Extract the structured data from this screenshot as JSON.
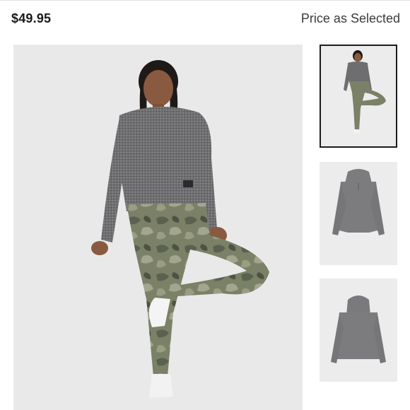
{
  "product": {
    "price": "$49.95",
    "price_note": "Price as Selected"
  },
  "gallery": {
    "main_image_label": "model wearing grey cropped hoodie and camo leggings",
    "thumbnails": [
      {
        "subject": "full outfit on model",
        "selected": true
      },
      {
        "subject": "grey hoodie front",
        "selected": false
      },
      {
        "subject": "grey hoodie back",
        "selected": false
      }
    ]
  },
  "colors": {
    "background": "#ffffff",
    "image_backdrop": "#e9e9ea",
    "hoodie_grey": "#6d6d6f",
    "camo_green": "#7a8166",
    "selected_border": "#1b1b1b"
  }
}
